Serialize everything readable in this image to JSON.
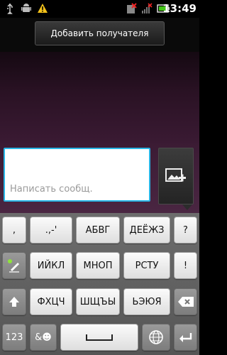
{
  "status_bar": {
    "time": "13:49",
    "icons": [
      "usb-icon",
      "android-debug-icon",
      "warning-icon",
      "no-sim-icon",
      "signal-icon",
      "battery-icon"
    ]
  },
  "header": {
    "add_recipient_label": "Добавить получателя"
  },
  "compose": {
    "placeholder": "Написать сообщ."
  },
  "keyboard": {
    "row1": [
      ",",
      ".,-'",
      "АБВГ",
      "ДЕЁЖЗ",
      "?"
    ],
    "row2": [
      "ИЙКЛ",
      "МНОП",
      "РСТУ",
      "!"
    ],
    "row3": [
      "ФХЦЧ",
      "ШЩЪЫ",
      "ЬЭЮЯ"
    ],
    "row4": [
      "123",
      "&☻"
    ]
  },
  "colors": {
    "accent": "#29b6e6",
    "background": "#3a1a33"
  }
}
